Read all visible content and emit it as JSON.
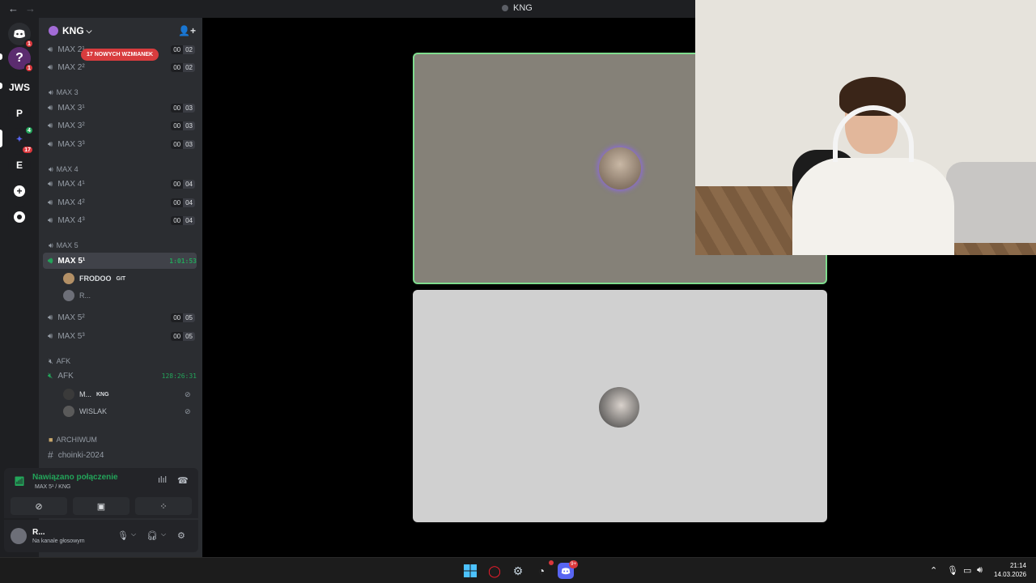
{
  "window": {
    "title": "KNG",
    "back": "←",
    "forward": "→"
  },
  "servers": [
    {
      "label": "",
      "icon": "discord-icon",
      "badge": "1"
    },
    {
      "label": "",
      "icon": "question-server-icon",
      "badge": "1"
    },
    {
      "label": "JWS"
    },
    {
      "label": "P"
    },
    {
      "label": "",
      "icon": "kng-server-icon",
      "badge": "17",
      "badge2": "4"
    },
    {
      "label": "E"
    },
    {
      "label": "+",
      "icon": "add-server-icon"
    },
    {
      "label": "",
      "icon": "compass-icon"
    }
  ],
  "server": {
    "name": "KNG",
    "chevron": "⌵",
    "invite": "👤+"
  },
  "mention_banner": "17 NOWYCH WZMIANEK",
  "channels": {
    "max2": [
      {
        "name": "MAX 2¹",
        "lim": [
          "00",
          "02"
        ]
      },
      {
        "name": "MAX 2²",
        "lim": [
          "00",
          "02"
        ]
      }
    ],
    "cat3": "MAX 3",
    "max3": [
      {
        "name": "MAX 3¹",
        "lim": [
          "00",
          "03"
        ]
      },
      {
        "name": "MAX 3²",
        "lim": [
          "00",
          "03"
        ]
      },
      {
        "name": "MAX 3³",
        "lim": [
          "00",
          "03"
        ]
      }
    ],
    "cat4": "MAX 4",
    "max4": [
      {
        "name": "MAX 4¹",
        "lim": [
          "00",
          "04"
        ]
      },
      {
        "name": "MAX 4²",
        "lim": [
          "00",
          "04"
        ]
      },
      {
        "name": "MAX 4³",
        "lim": [
          "00",
          "04"
        ]
      }
    ],
    "cat5": "MAX 5",
    "active": {
      "name": "MAX 5¹",
      "timer": "1:01:53"
    },
    "members": [
      {
        "name": "FRODOO",
        "tag": "GIT"
      },
      {
        "name": "R..."
      }
    ],
    "max5": [
      {
        "name": "MAX 5²",
        "lim": [
          "00",
          "05"
        ]
      },
      {
        "name": "MAX 5³",
        "lim": [
          "00",
          "05"
        ]
      }
    ],
    "cat_afk": "AFK",
    "afk": {
      "name": "AFK",
      "timer": "128:26:31"
    },
    "afk_members": [
      {
        "name": "M...",
        "tag": "KNG"
      },
      {
        "name": "WISLAK"
      }
    ],
    "cat_archive": "ARCHIWUM",
    "archive": {
      "name": "choinki-2024"
    }
  },
  "voice": {
    "status": "Nawiązano połączenie",
    "channel": "MAX 5¹ / KNG"
  },
  "user": {
    "name": "R...",
    "status": "Na kanale głosowym"
  },
  "clock": {
    "time": "21:14",
    "date": "14.03.2026"
  },
  "taskbar": {
    "discord_badge": "9+"
  }
}
